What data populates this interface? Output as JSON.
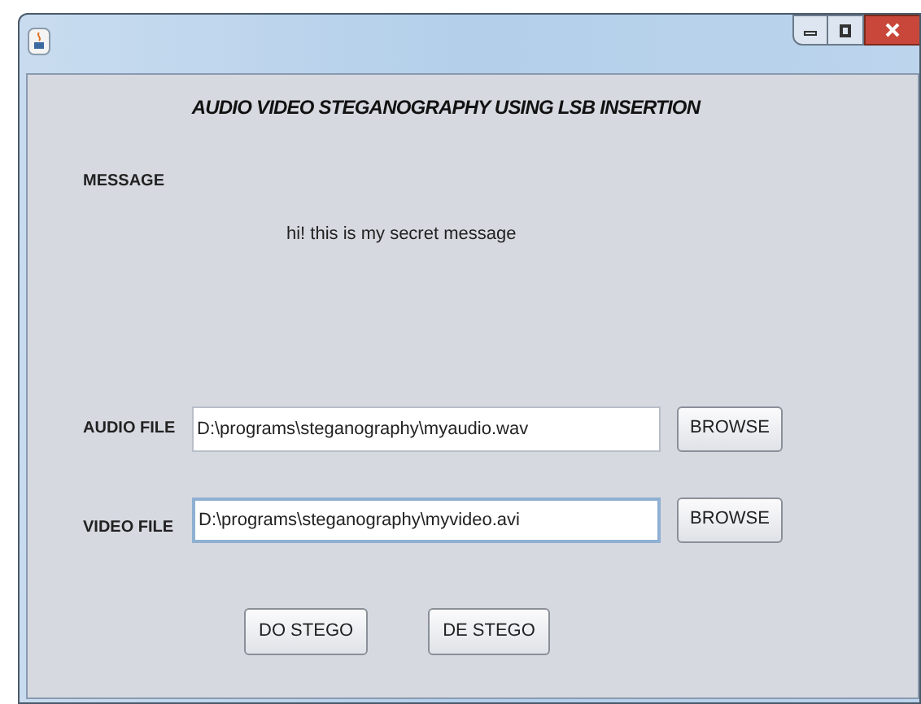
{
  "heading": "AUDIO VIDEO STEGANOGRAPHY USING LSB INSERTION",
  "message": {
    "label": "MESSAGE",
    "text": "hi! this is my secret message"
  },
  "files": [
    {
      "label": "AUDIO FILE",
      "value": "D:\\programs\\steganography\\myaudio.wav",
      "focused": false,
      "button": "BROWSE"
    },
    {
      "label": "VIDEO FILE",
      "value": "D:\\programs\\steganography\\myvideo.avi",
      "focused": true,
      "button": "BROWSE"
    }
  ],
  "actions": [
    "DO STEGO",
    "DE STEGO"
  ]
}
